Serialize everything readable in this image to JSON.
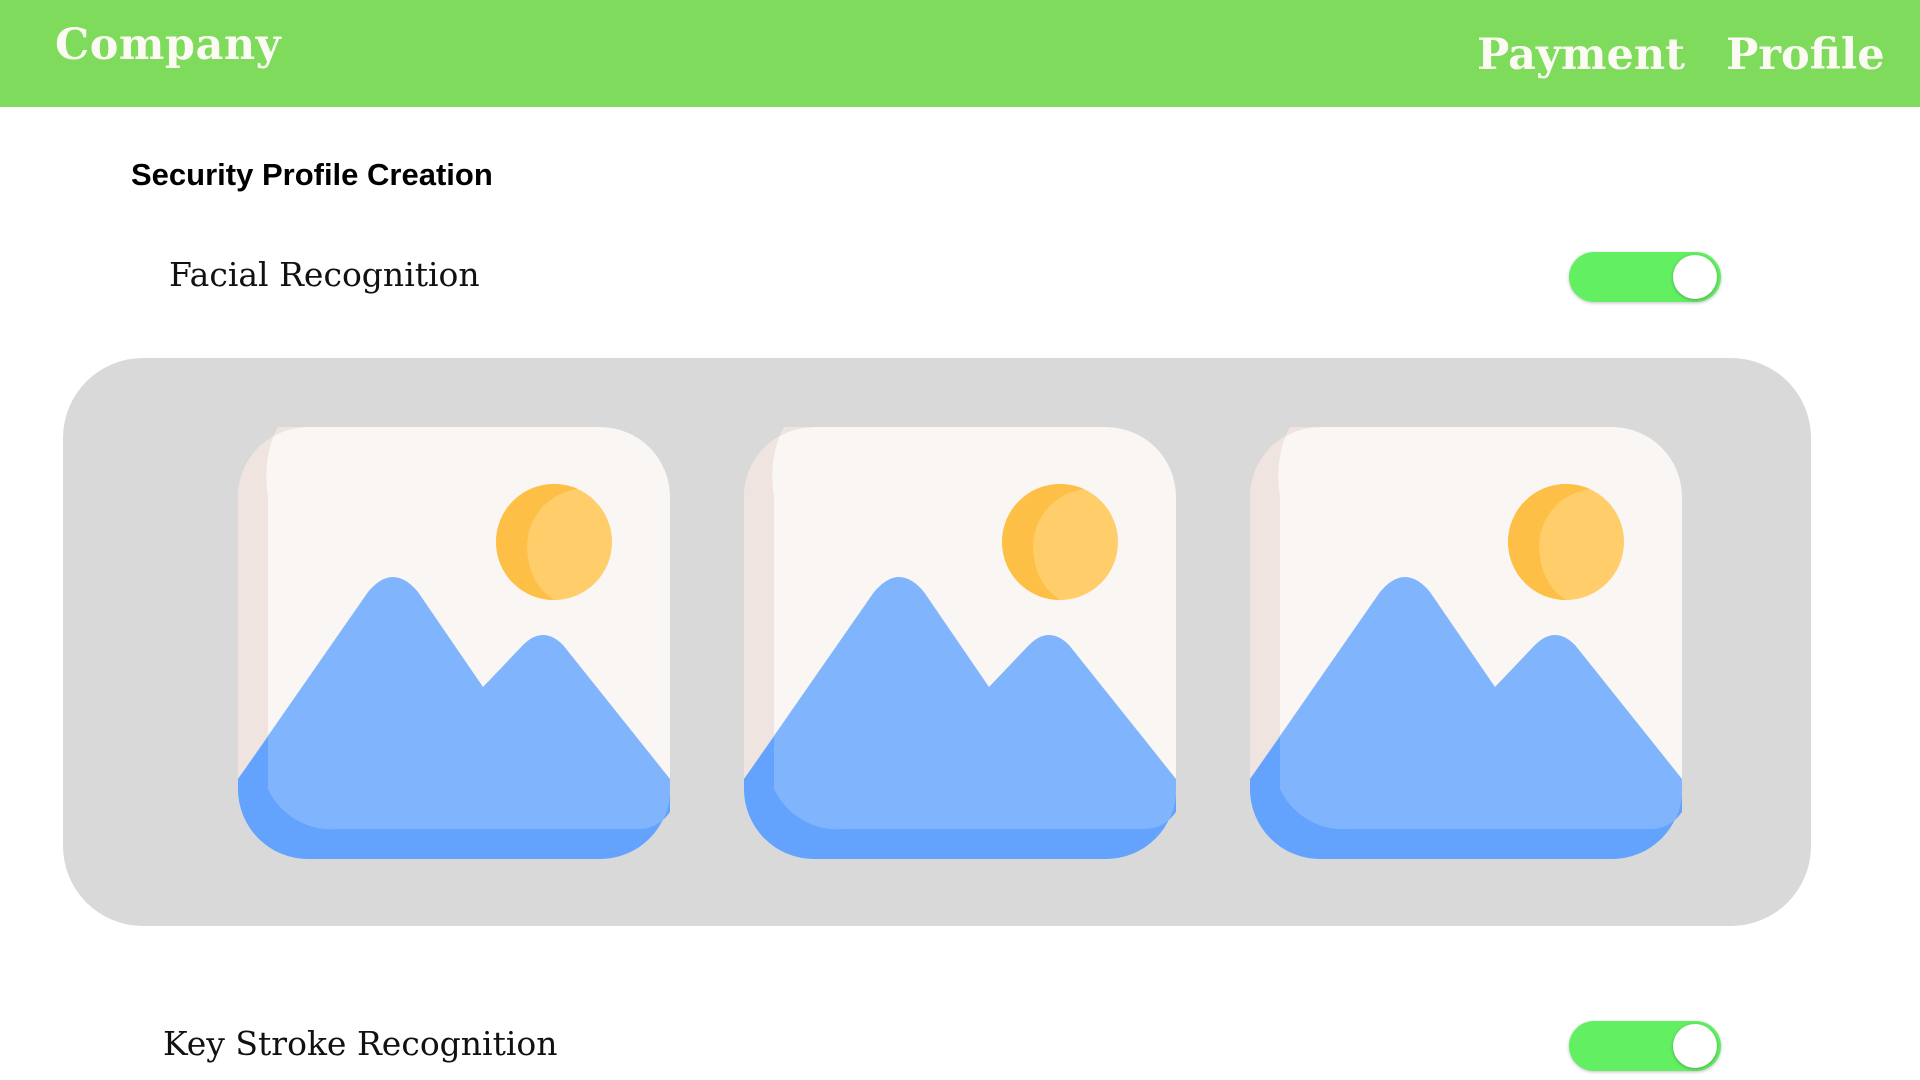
{
  "header": {
    "brand": "Company",
    "nav": [
      {
        "label": "Payment"
      },
      {
        "label": "Profile"
      }
    ],
    "background_color": "#7edb5b"
  },
  "main": {
    "title": "Security Profile Creation",
    "sections": [
      {
        "label": "Facial Recognition",
        "toggle_on": true
      },
      {
        "label": "Key Stroke Recognition",
        "toggle_on": true
      }
    ],
    "gallery": {
      "images": [
        {
          "icon": "image-placeholder-icon"
        },
        {
          "icon": "image-placeholder-icon"
        },
        {
          "icon": "image-placeholder-icon"
        }
      ]
    },
    "toggle_color": "#62ef62"
  }
}
